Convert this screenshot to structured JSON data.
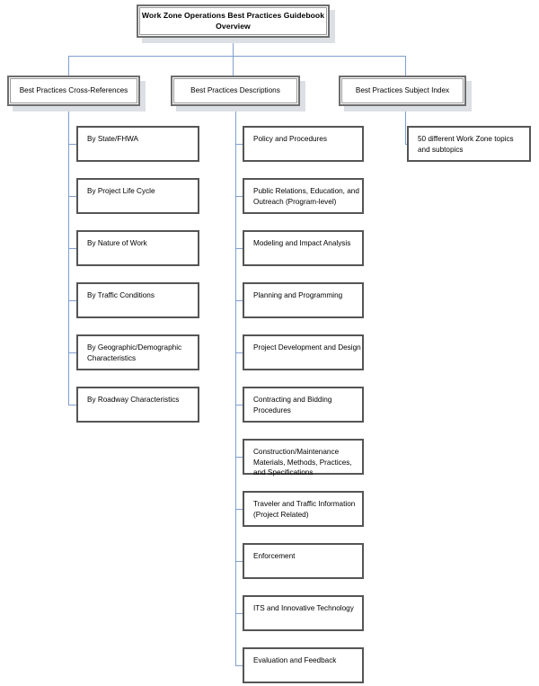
{
  "diagram": {
    "title": "Work Zone Operations Best Practices Guidebook Overview",
    "root": {
      "label": "Work Zone Operations Best Practices Guidebook\nOverview"
    },
    "level2": [
      {
        "id": "cross-references",
        "label": "Best Practices Cross-References"
      },
      {
        "id": "descriptions",
        "label": "Best Practices Descriptions"
      },
      {
        "id": "subject-index",
        "label": "Best Practices Subject Index"
      }
    ],
    "branches": {
      "cross_references": [
        {
          "label": "By State/FHWA"
        },
        {
          "label": "By Project Life Cycle"
        },
        {
          "label": "By Nature of Work"
        },
        {
          "label": "By Traffic Conditions"
        },
        {
          "label": "By Geographic/Demographic\nCharacteristics"
        },
        {
          "label": "By Roadway Characteristics"
        }
      ],
      "descriptions": [
        {
          "label": "Policy and Procedures"
        },
        {
          "label": "Public Relations, Education, and\nOutreach (Program-level)"
        },
        {
          "label": "Modeling and Impact Analysis"
        },
        {
          "label": "Planning and Programming"
        },
        {
          "label": "Project Development and Design"
        },
        {
          "label": "Contracting and Bidding\nProcedures"
        },
        {
          "label": "Construction/Maintenance\nMaterials, Methods, Practices,\nand Specifications"
        },
        {
          "label": "Traveler and Traffic Information\n(Project Related)"
        },
        {
          "label": "Enforcement"
        },
        {
          "label": "ITS and Innovative Technology"
        },
        {
          "label": "Evaluation and Feedback"
        }
      ],
      "subject_index": [
        {
          "label": "50 different Work Zone topics\nand subtopics"
        }
      ]
    },
    "colors": {
      "connector": "#7f9fd1",
      "box_border": "#555555",
      "header_border": "#6e6e6e",
      "shadow": "#dcdfe3",
      "background": "#ffffff",
      "text": "#000000"
    }
  }
}
